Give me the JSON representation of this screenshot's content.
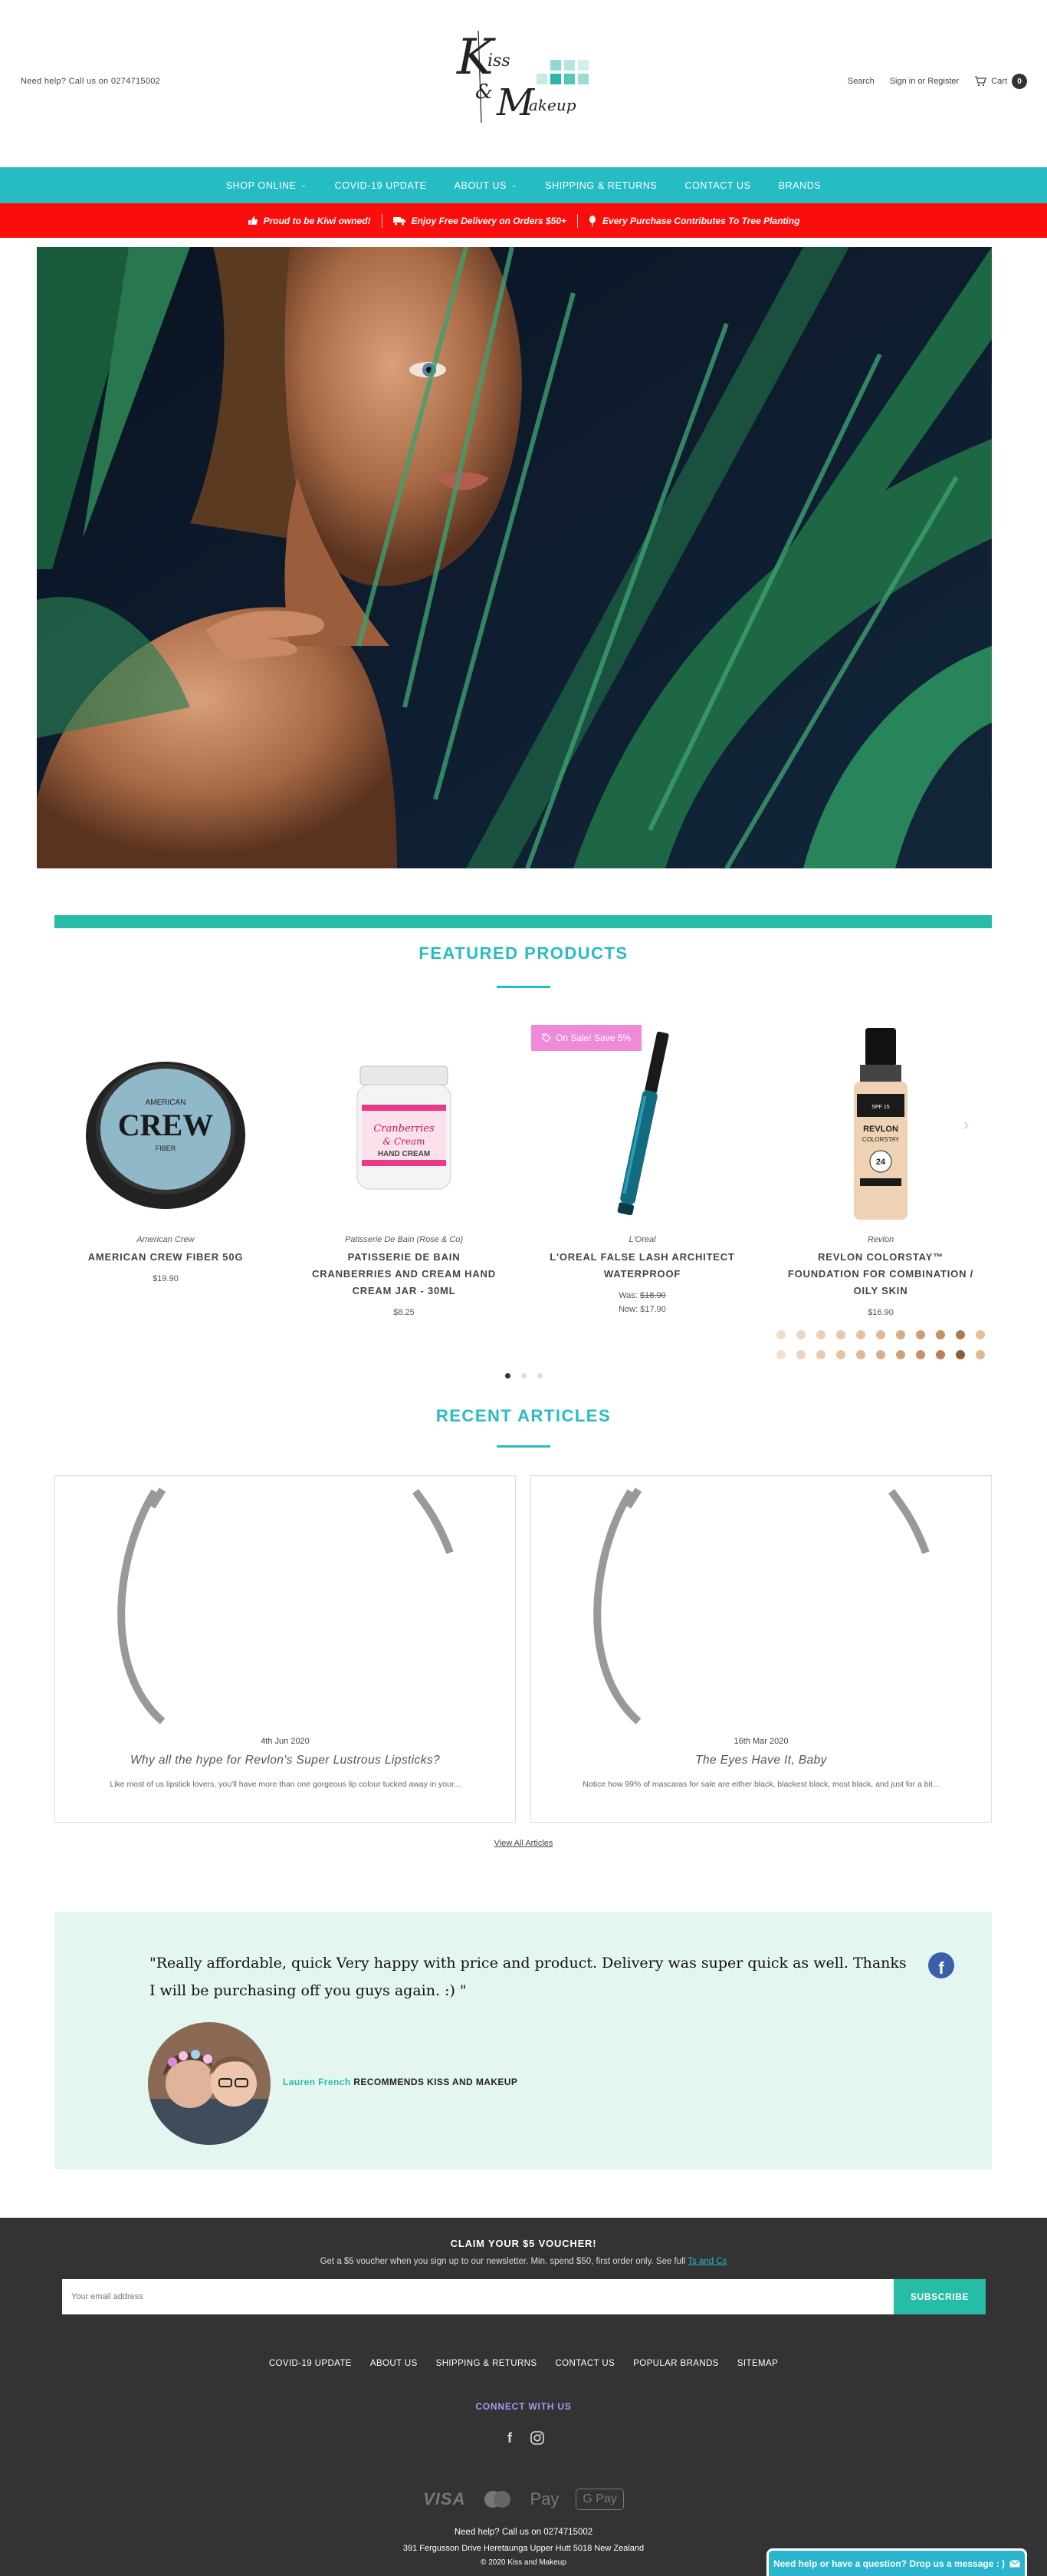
{
  "header": {
    "help_text": "Need help? Call us on 0274715002",
    "logo_text": "Kiss & Makeup",
    "search_label": "Search",
    "signin_label": "Sign in or Register",
    "cart_label": "Cart",
    "cart_count": "0"
  },
  "nav": {
    "items": [
      {
        "label": "SHOP ONLINE",
        "has_dropdown": true
      },
      {
        "label": "COVID-19 UPDATE",
        "has_dropdown": false
      },
      {
        "label": "ABOUT US",
        "has_dropdown": true
      },
      {
        "label": "SHIPPING & RETURNS",
        "has_dropdown": false
      },
      {
        "label": "CONTACT US",
        "has_dropdown": false
      },
      {
        "label": "BRANDS",
        "has_dropdown": false
      }
    ]
  },
  "promo": {
    "items": [
      {
        "icon": "thumbs-up-icon",
        "text": "Proud to be Kiwi owned!"
      },
      {
        "icon": "truck-icon",
        "text": "Enjoy Free Delivery on Orders $50+"
      },
      {
        "icon": "tree-icon",
        "text": "Every Purchase Contributes To Tree Planting"
      }
    ]
  },
  "featured": {
    "title": "FEATURED PRODUCTS",
    "products": [
      {
        "brand": "American Crew",
        "name": "AMERICAN CREW FIBER 50G",
        "price": "$19.90"
      },
      {
        "brand": "Patisserie De Bain (Rose & Co)",
        "name": "PATISSERIE DE BAIN CRANBERRIES AND CREAM HAND CREAM JAR - 30ML",
        "price": "$8.25"
      },
      {
        "brand": "L'Oreal",
        "name": "L'OREAL FALSE LASH ARCHITECT WATERPROOF",
        "was_label": "Was:",
        "was_price": "$18.90",
        "now_label": "Now:",
        "now_price": "$17.90",
        "badge": "On Sale! Save 5%"
      },
      {
        "brand": "Revlon",
        "name": "REVLON COLORSTAY™ FOUNDATION FOR COMBINATION / OILY SKIN",
        "price": "$16.90"
      }
    ],
    "swatches": [
      "#f1dcc9",
      "#efd5bf",
      "#ecceb3",
      "#e8c8aa",
      "#e4c09f",
      "#dfb894",
      "#d8ad85",
      "#cf9f74",
      "#c49163",
      "#b07a4e",
      "#e6bf9b",
      "#f3dfcf",
      "#eed2bd",
      "#e9cbb0",
      "#e5c3a3",
      "#dfb996",
      "#d8ae88",
      "#d0a27a",
      "#c5936a",
      "#b88259",
      "#8d5b36",
      "#e2b890"
    ],
    "pagination": {
      "total": 3,
      "active": 1
    }
  },
  "articles": {
    "title": "RECENT ARTICLES",
    "items": [
      {
        "date": "4th Jun 2020",
        "title": "Why all the hype for Revlon's Super Lustrous Lipsticks?",
        "excerpt": "Like most of us lipstick lovers, you'll have more than one gorgeous lip colour tucked away in your..."
      },
      {
        "date": "16th Mar 2020",
        "title": "The Eyes Have It, Baby",
        "excerpt": "Notice how 99% of mascaras for sale are either black, blackest black, most black, and just for a bit..."
      }
    ],
    "view_all": "View All Articles"
  },
  "testimonial": {
    "quote": "\"Really affordable, quick Very happy with price and product. Delivery was super quick as well. Thanks I will be purchasing off you guys again. :) \"",
    "name": "Lauren French",
    "recommends": "RECOMMENDS KISS AND MAKEUP"
  },
  "footer": {
    "claim_title": "CLAIM YOUR $5 VOUCHER!",
    "claim_text": "Get a $5 voucher when you sign up to our newsletter. Min. spend $50, first order only. See full",
    "claim_link": "Ts and Cs",
    "email_placeholder": "Your email address",
    "subscribe_label": "SUBSCRIBE",
    "links": [
      "COVID-19 UPDATE",
      "ABOUT US",
      "SHIPPING & RETURNS",
      "CONTACT US",
      "POPULAR BRANDS",
      "SITEMAP"
    ],
    "connect": "CONNECT WITH US",
    "payments": [
      "VISA",
      "Mastercard",
      "Pay",
      "G Pay"
    ],
    "help_text": "Need help? Call us on 0274715002",
    "address": "391 Fergusson Drive Heretaunga Upper Hutt 5018 New Zealand",
    "copyright": "© 2020 Kiss and Makeup"
  },
  "chat": {
    "label": "Need help or have a question? Drop us a message : )"
  },
  "colors": {
    "teal": "#26bcc4",
    "promo_red": "#fa0d0d",
    "footer_bg": "#333333",
    "sale_pink": "#ef8ad8",
    "testimonial_bg": "#e4f6f0"
  }
}
